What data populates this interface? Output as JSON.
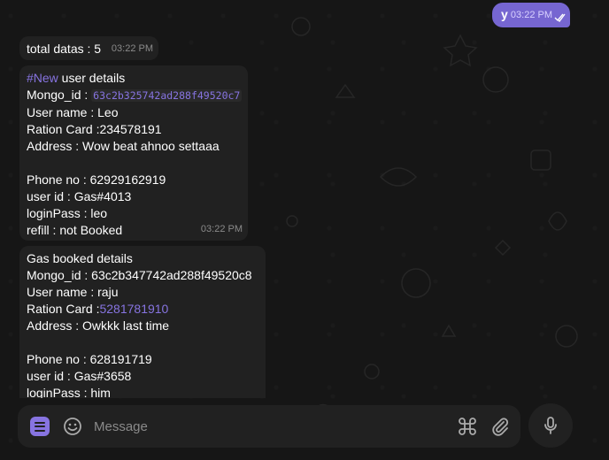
{
  "chat": {
    "outgoing": {
      "text": "y",
      "time": "03:22 PM"
    },
    "messages": [
      {
        "lines": [
          "total datas : 5"
        ],
        "time": "03:22 PM"
      },
      {
        "hashtag": "#New",
        "title_rest": " user details",
        "mongo_label": "Mongo_id : ",
        "mongo_id": "63c2b325742ad288f49520c7",
        "lines": [
          "User name : Leo",
          "Ration Card :234578191",
          "Address : Wow beat ahnoo settaaa",
          "",
          "Phone no : 62929162919",
          "user id : Gas#4013",
          "loginPass : leo",
          "refill : not Booked"
        ],
        "time": "03:22 PM"
      },
      {
        "title": "Gas booked details",
        "mongo_line": "Mongo_id : 63c2b347742ad288f49520c8",
        "user_line": "User name : raju",
        "ration_label": "Ration Card :",
        "ration_value": "5281781910",
        "lines": [
          "Address : Owkkk last time",
          "",
          "Phone no : 628191719",
          "user id : Gas#3658",
          "loginPass : him"
        ]
      }
    ]
  },
  "composer": {
    "placeholder": "Message",
    "icons": [
      "menu-icon",
      "emoji-icon",
      "command-icon",
      "paperclip-icon",
      "microphone-icon"
    ]
  },
  "colors": {
    "accent": "#8774e1",
    "bubble": "#212121",
    "outgoing": "#7666d1"
  }
}
